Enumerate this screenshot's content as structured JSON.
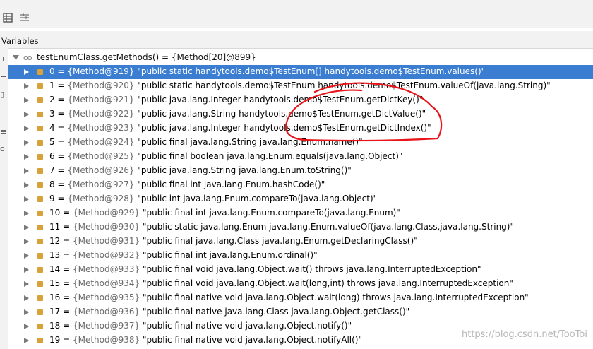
{
  "panel": {
    "title": "Variables"
  },
  "toolbar": {
    "icons": [
      "table-icon",
      "list-settings-icon"
    ]
  },
  "side_icons": [
    "plus-icon",
    "minus-icon",
    "clipboard-icon",
    "copy-icon",
    "watch-icon"
  ],
  "root": {
    "label": "testEnumClass.getMethods() = {Method[20]@899}",
    "expanded": true
  },
  "rows": [
    {
      "idx": "0 = ",
      "ref": "{Method@919}",
      "text": " \"public static handytools.demo$TestEnum[] handytools.demo$TestEnum.values()\"",
      "selected": true
    },
    {
      "idx": "1 = ",
      "ref": "{Method@920}",
      "text": " \"public static handytools.demo$TestEnum handytools.demo$TestEnum.valueOf(java.lang.String)\""
    },
    {
      "idx": "2 = ",
      "ref": "{Method@921}",
      "text": " \"public java.lang.Integer handytools.demo$TestEnum.getDictKey()\""
    },
    {
      "idx": "3 = ",
      "ref": "{Method@922}",
      "text": " \"public java.lang.String handytools.demo$TestEnum.getDictValue()\""
    },
    {
      "idx": "4 = ",
      "ref": "{Method@923}",
      "text": " \"public java.lang.Integer handytools.demo$TestEnum.getDictIndex()\""
    },
    {
      "idx": "5 = ",
      "ref": "{Method@924}",
      "text": " \"public final java.lang.String java.lang.Enum.name()\""
    },
    {
      "idx": "6 = ",
      "ref": "{Method@925}",
      "text": " \"public final boolean java.lang.Enum.equals(java.lang.Object)\""
    },
    {
      "idx": "7 = ",
      "ref": "{Method@926}",
      "text": " \"public java.lang.String java.lang.Enum.toString()\""
    },
    {
      "idx": "8 = ",
      "ref": "{Method@927}",
      "text": " \"public final int java.lang.Enum.hashCode()\""
    },
    {
      "idx": "9 = ",
      "ref": "{Method@928}",
      "text": " \"public int java.lang.Enum.compareTo(java.lang.Object)\""
    },
    {
      "idx": "10 = ",
      "ref": "{Method@929}",
      "text": " \"public final int java.lang.Enum.compareTo(java.lang.Enum)\""
    },
    {
      "idx": "11 = ",
      "ref": "{Method@930}",
      "text": " \"public static java.lang.Enum java.lang.Enum.valueOf(java.lang.Class,java.lang.String)\""
    },
    {
      "idx": "12 = ",
      "ref": "{Method@931}",
      "text": " \"public final java.lang.Class java.lang.Enum.getDeclaringClass()\""
    },
    {
      "idx": "13 = ",
      "ref": "{Method@932}",
      "text": " \"public final int java.lang.Enum.ordinal()\""
    },
    {
      "idx": "14 = ",
      "ref": "{Method@933}",
      "text": " \"public final void java.lang.Object.wait() throws java.lang.InterruptedException\""
    },
    {
      "idx": "15 = ",
      "ref": "{Method@934}",
      "text": " \"public final void java.lang.Object.wait(long,int) throws java.lang.InterruptedException\""
    },
    {
      "idx": "16 = ",
      "ref": "{Method@935}",
      "text": " \"public final native void java.lang.Object.wait(long) throws java.lang.InterruptedException\""
    },
    {
      "idx": "17 = ",
      "ref": "{Method@936}",
      "text": " \"public final native java.lang.Class java.lang.Object.getClass()\""
    },
    {
      "idx": "18 = ",
      "ref": "{Method@937}",
      "text": " \"public final native void java.lang.Object.notify()\""
    },
    {
      "idx": "19 = ",
      "ref": "{Method@938}",
      "text": " \"public final native void java.lang.Object.notifyAll()\""
    }
  ],
  "watermark": "https://blog.csdn.net/TooToi",
  "colors": {
    "selection": "#3a7dd1",
    "field_icon": "#d7a23a",
    "annotation": "#e8141a"
  }
}
